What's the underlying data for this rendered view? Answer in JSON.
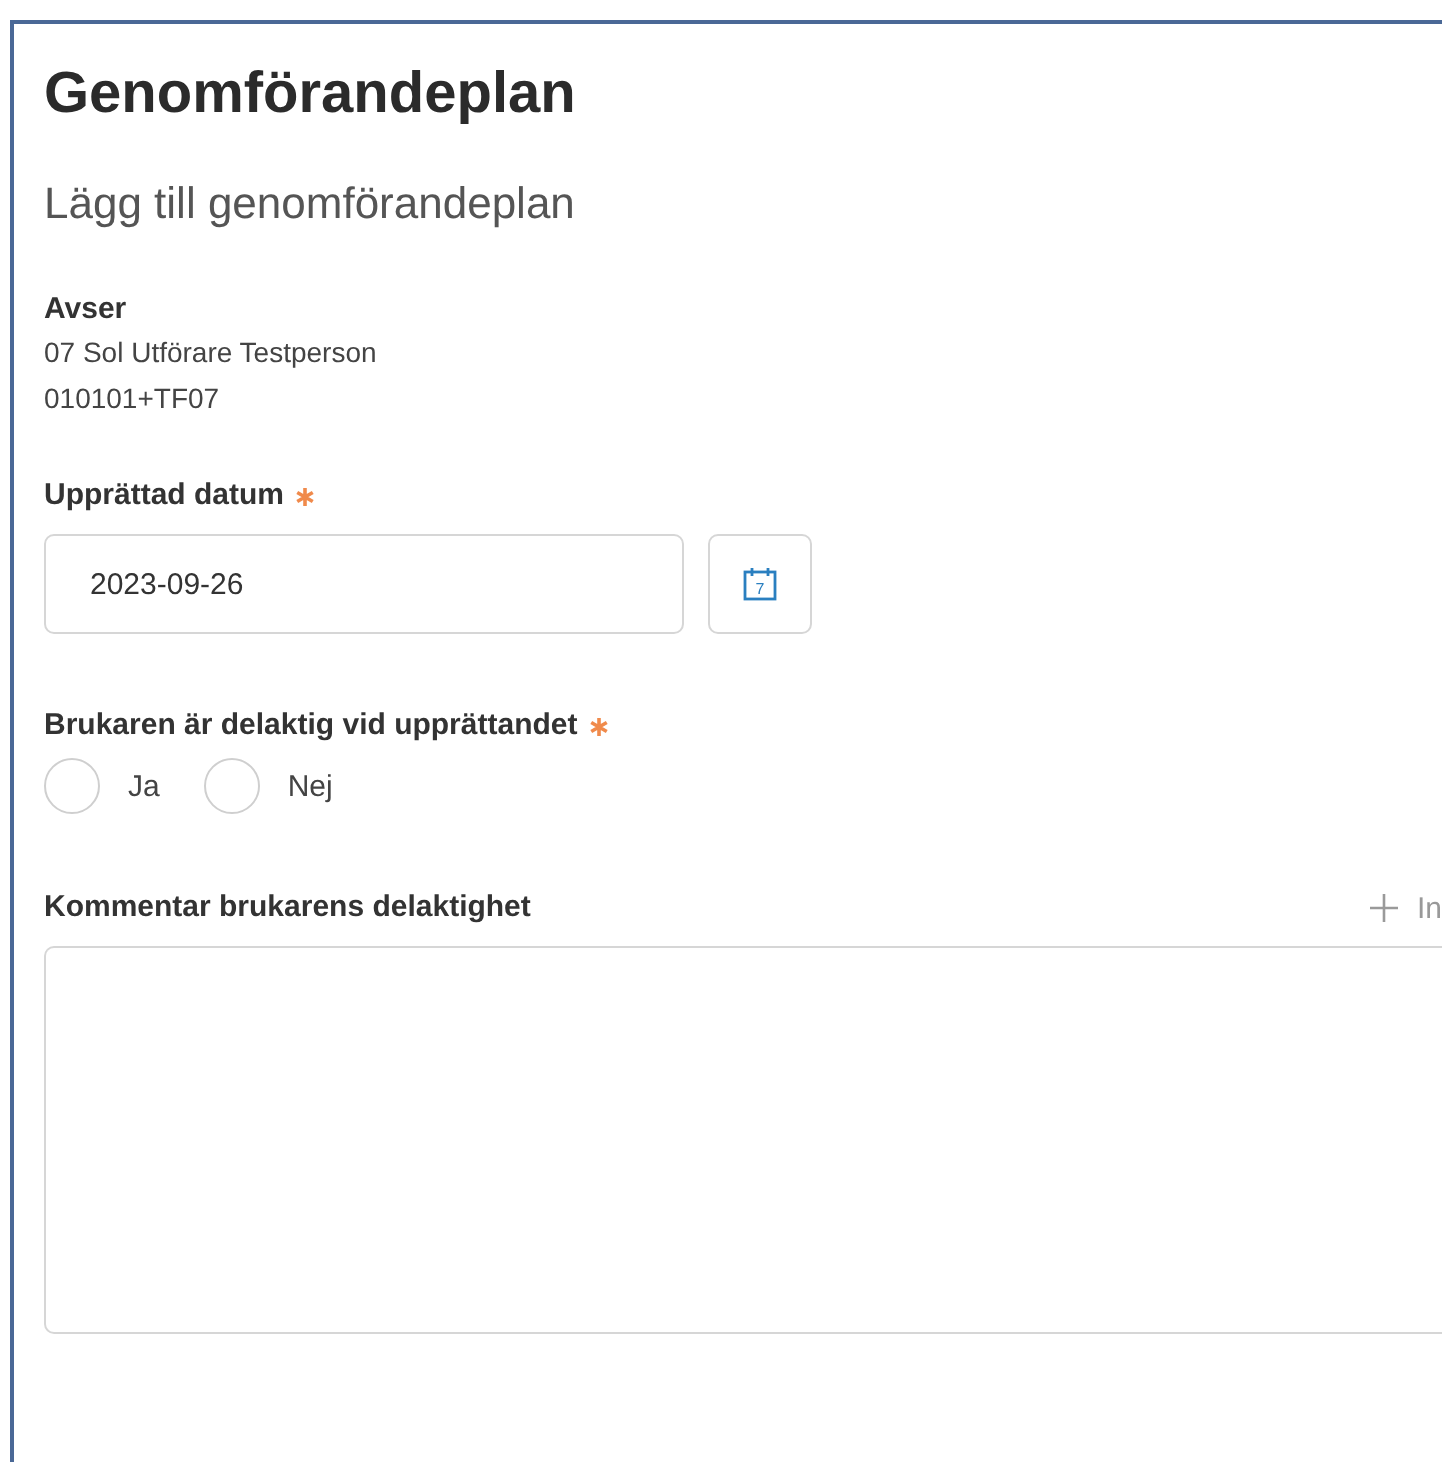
{
  "heading": "Genomförandeplan",
  "subheading": "Lägg till genomförandeplan",
  "subject": {
    "label": "Avser",
    "lines": [
      "07 Sol Utförare Testperson",
      "010101+TF07"
    ]
  },
  "date_field": {
    "label": "Upprättad datum",
    "required": true,
    "value": "2023-09-26",
    "calendar_day": "7"
  },
  "participation": {
    "label": "Brukaren är delaktig vid upprättandet",
    "required": true,
    "options": [
      {
        "label": "Ja",
        "selected": false
      },
      {
        "label": "Nej",
        "selected": false
      }
    ]
  },
  "comment": {
    "label": "Kommentar brukarens delaktighet",
    "action": "In"
  }
}
